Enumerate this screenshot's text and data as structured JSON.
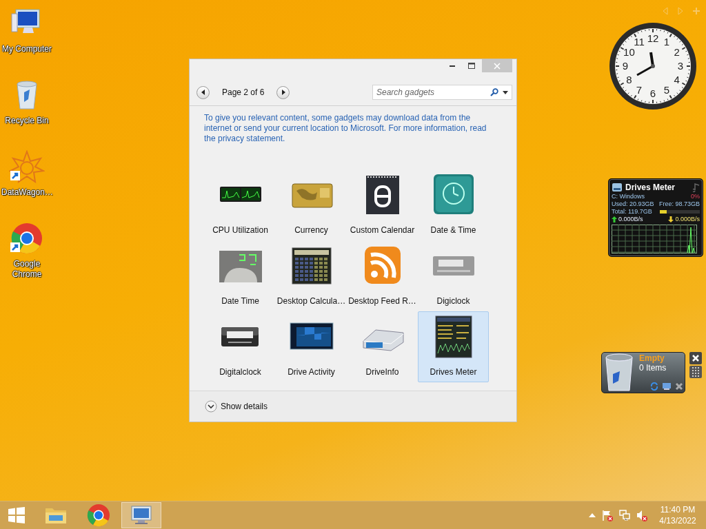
{
  "desktop_icons": [
    {
      "label": "My Computer",
      "kind": "computer"
    },
    {
      "label": "Recycle Bin",
      "kind": "bin"
    },
    {
      "label": "DataWagon…",
      "kind": "mandala"
    },
    {
      "label": "Google Chrome",
      "kind": "chrome"
    }
  ],
  "gadget_gallery": {
    "pager": {
      "label": "Page 2 of 6"
    },
    "search": {
      "placeholder": "Search gadgets"
    },
    "notice": "To give you relevant content, some gadgets may download data from the internet or send your current location to Microsoft. For more information, read the privacy statement.",
    "gadgets": [
      {
        "name": "CPU Utilization",
        "kind": "cpu",
        "selected": false
      },
      {
        "name": "Currency",
        "kind": "currency",
        "selected": false
      },
      {
        "name": "Custom Calendar",
        "kind": "calendar",
        "selected": false
      },
      {
        "name": "Date & Time",
        "kind": "clock",
        "selected": false
      },
      {
        "name": "Date Time",
        "kind": "photoclock",
        "selected": false
      },
      {
        "name": "Desktop Calcula…",
        "kind": "calculator",
        "selected": false
      },
      {
        "name": "Desktop Feed R…",
        "kind": "feed",
        "selected": false
      },
      {
        "name": "Digiclock",
        "kind": "digiclock",
        "selected": false
      },
      {
        "name": "Digitalclock",
        "kind": "digitalclock",
        "selected": false
      },
      {
        "name": "Drive Activity",
        "kind": "activity",
        "selected": false
      },
      {
        "name": "DriveInfo",
        "kind": "drive",
        "selected": false
      },
      {
        "name": "Drives Meter",
        "kind": "meter",
        "selected": true
      }
    ],
    "details_toggle": {
      "label": "Show details"
    }
  },
  "clock_gadget": {
    "numerals": [
      "12",
      "11",
      "1",
      "10",
      "2",
      "9",
      "3",
      "8",
      "4",
      "7",
      "5",
      "6"
    ]
  },
  "drives_meter": {
    "title": "Drives Meter",
    "drive": "C: Windows",
    "percent": "0%",
    "used": "Used: 20.93GB",
    "free": "Free: 98.73GB",
    "total": "Total: 119.7GB",
    "level": 0.17,
    "upload": "0.000B/s",
    "download": "0.000B/s"
  },
  "recycle_gadget": {
    "status": "Empty",
    "count": "0 Items"
  },
  "taskbar": {
    "apps": [
      {
        "kind": "explorer",
        "selected": false
      },
      {
        "kind": "chrome",
        "selected": false
      },
      {
        "kind": "gadgets",
        "selected": true
      }
    ],
    "time": "11:40 PM",
    "date": "4/13/2022"
  }
}
